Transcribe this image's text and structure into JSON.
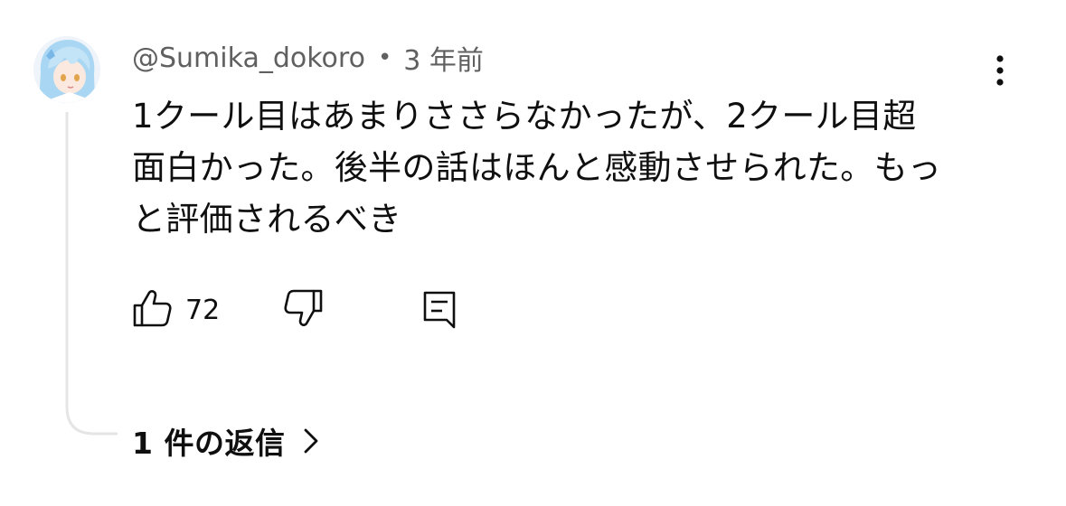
{
  "comment": {
    "author": "@Sumika_dokoro",
    "separator": "•",
    "time": "3 年前",
    "lines": [
      "1クール目はあまりささらなかったが、2クール目超",
      "面白かった。後半の話はほんと感動させられた。もっ",
      "と評価されるべき"
    ],
    "avatar_icon": "anime-character-avatar",
    "menu_icon": "more-vertical-icon"
  },
  "actions": {
    "like_icon": "thumbs-up-icon",
    "like_count": "72",
    "dislike_icon": "thumbs-down-icon",
    "reply_icon": "reply-comment-icon"
  },
  "replies": {
    "label": "1 件の返信",
    "icon": "chevron-right-icon"
  },
  "colors": {
    "text_primary": "#0f0f0f",
    "text_secondary": "#606060",
    "thread_line": "#e5e5e5",
    "avatar_hair": "#a9d6f2"
  }
}
